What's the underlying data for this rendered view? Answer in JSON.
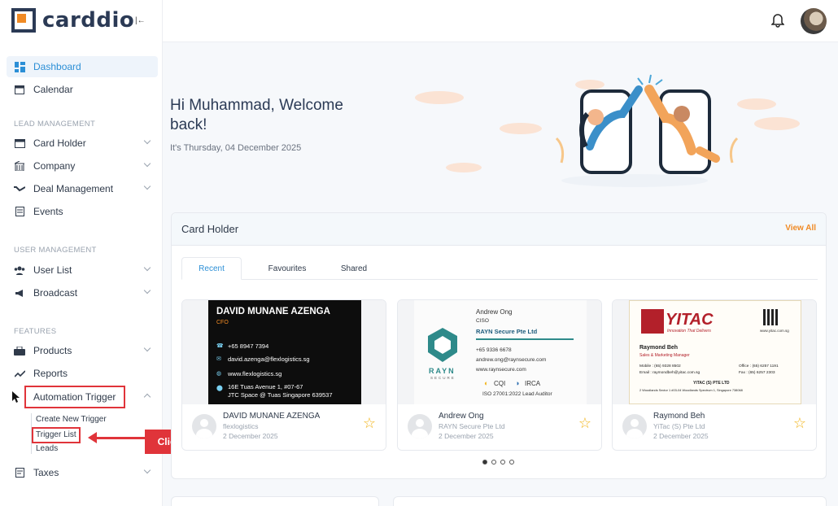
{
  "brand": {
    "name": "carddio",
    "accent": "#f08a24",
    "dark": "#2b3a55",
    "primary": "#2c8fd6",
    "annotation": "#e0343a"
  },
  "sidebar": {
    "dashboard": "Dashboard",
    "calendar": "Calendar",
    "section_lead": "LEAD MANAGEMENT",
    "card_holder": "Card Holder",
    "company": "Company",
    "deal_management": "Deal Management",
    "events": "Events",
    "section_user": "USER MANAGEMENT",
    "user_list": "User List",
    "broadcast": "Broadcast",
    "section_features": "FEATURES",
    "products": "Products",
    "reports": "Reports",
    "automation_trigger": "Automation Trigger",
    "sub_create": "Create New Trigger",
    "sub_list": "Trigger List",
    "sub_leads": "Leads",
    "taxes": "Taxes"
  },
  "annotation": {
    "callout": "Click here to list"
  },
  "welcome": {
    "title": "Hi Muhammad, Welcome back!",
    "date": "It's Thursday, 04 December 2025"
  },
  "card_holder": {
    "title": "Card Holder",
    "view_all": "View All",
    "tabs": [
      "Recent",
      "Favourites",
      "Shared"
    ],
    "cards": [
      {
        "name": "DAVID MUNANE AZENGA",
        "company": "flexlogistics",
        "date": "2 December 2025",
        "bc": {
          "name": "DAVID MUNANE AZENGA",
          "role": "CFO",
          "phone": "+65 8947 7394",
          "email": "david.azenga@flexlogistics.sg",
          "web": "www.flexlogistics.sg",
          "addr1": "16E Tuas Avenue 1, #07-67",
          "addr2": "JTC Space @ Tuas Singapore 639537"
        }
      },
      {
        "name": "Andrew Ong",
        "company": "RAYN Secure Pte Ltd",
        "date": "2 December 2025",
        "bc": {
          "name": "Andrew Ong",
          "role": "CISO",
          "company": "RAYN Secure Pte Ltd",
          "phone": "+65 9336 6678",
          "email": "andrew.ong@raynsecure.com",
          "web": "www.raynsecure.com",
          "logo": "RAYN",
          "logo_sub": "SECURE",
          "cert1": "CQI",
          "cert2": "IRCA",
          "cert3": "ISO 27001:2022 Lead Auditor"
        }
      },
      {
        "name": "Raymond Beh",
        "company": "YiTac (S) Pte Ltd",
        "date": "2 December 2025",
        "bc": {
          "logo": "YITAC",
          "tagline": "Innovation That Delivers",
          "web": "www.yitac.com.sg",
          "name": "Raymond Beh",
          "role": "Sales & Marketing Manager",
          "mobile": "Mobile : (65) 9328 8502",
          "email": "Email : raymondbeh@yitac.com.sg",
          "office": "Office : (65) 6257 1191",
          "fax": "Fax : (65) 6257 2303",
          "company": "YITAC (S) PTE LTD",
          "addr": "2 Woodlands Sector 1 #03-04 Woodlands Spectrum 1, Singapore 738068"
        }
      }
    ]
  }
}
